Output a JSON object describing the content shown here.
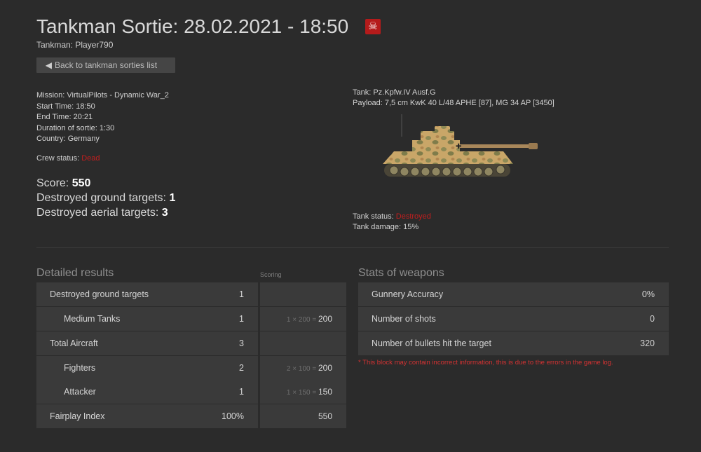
{
  "header": {
    "title": "Tankman Sortie: 28.02.2021 - 18:50",
    "subtitle": "Tankman: Player790",
    "back_label": "Back to tankman sorties list"
  },
  "mission": {
    "mission": "Mission: VirtualPilots - Dynamic War_2",
    "start": "Start Time: 18:50",
    "end": "End Time: 20:21",
    "duration": "Duration of sortie: 1:30",
    "country": "Country: Germany",
    "crew_label": "Crew status: ",
    "crew_value": "Dead"
  },
  "summary": {
    "score_label": "Score: ",
    "score_value": "550",
    "ground_label": "Destroyed ground targets: ",
    "ground_value": "1",
    "aerial_label": "Destroyed aerial targets: ",
    "aerial_value": "3"
  },
  "tank": {
    "name": "Tank: Pz.Kpfw.IV Ausf.G",
    "payload": "Payload: 7,5 cm KwK 40 L/48 APHE [87], MG 34 AP [3450]",
    "status_label": "Tank status: ",
    "status_value": "Destroyed",
    "damage": "Tank damage: 15%"
  },
  "detailed": {
    "heading": "Detailed results",
    "scoring_heading": "Scoring",
    "rows": [
      {
        "label": "Destroyed ground targets",
        "value": "1",
        "formula": "",
        "points": ""
      },
      {
        "label": "Medium Tanks",
        "value": "1",
        "formula": "1 × 200 = ",
        "points": "200"
      },
      {
        "label": "Total Aircraft",
        "value": "3",
        "formula": "",
        "points": ""
      },
      {
        "label": "Fighters",
        "value": "2",
        "formula": "2 × 100 = ",
        "points": "200"
      },
      {
        "label": "Attacker",
        "value": "1",
        "formula": "1 × 150 = ",
        "points": "150"
      },
      {
        "label": "Fairplay Index",
        "value": "100%",
        "formula": "",
        "points": "550"
      }
    ]
  },
  "weapons": {
    "heading": "Stats of weapons",
    "rows": [
      {
        "label": "Gunnery Accuracy",
        "value": "0%"
      },
      {
        "label": "Number of shots",
        "value": "0"
      },
      {
        "label": "Number of bullets hit the target",
        "value": "320"
      }
    ],
    "note": "* This block may contain incorrect information, this is due to the errors in the game log."
  },
  "colors": {
    "background": "#2b2b2b",
    "row": "#3a3a3a",
    "alert": "#c21e1e",
    "skull_badge": "#b51b1b"
  }
}
